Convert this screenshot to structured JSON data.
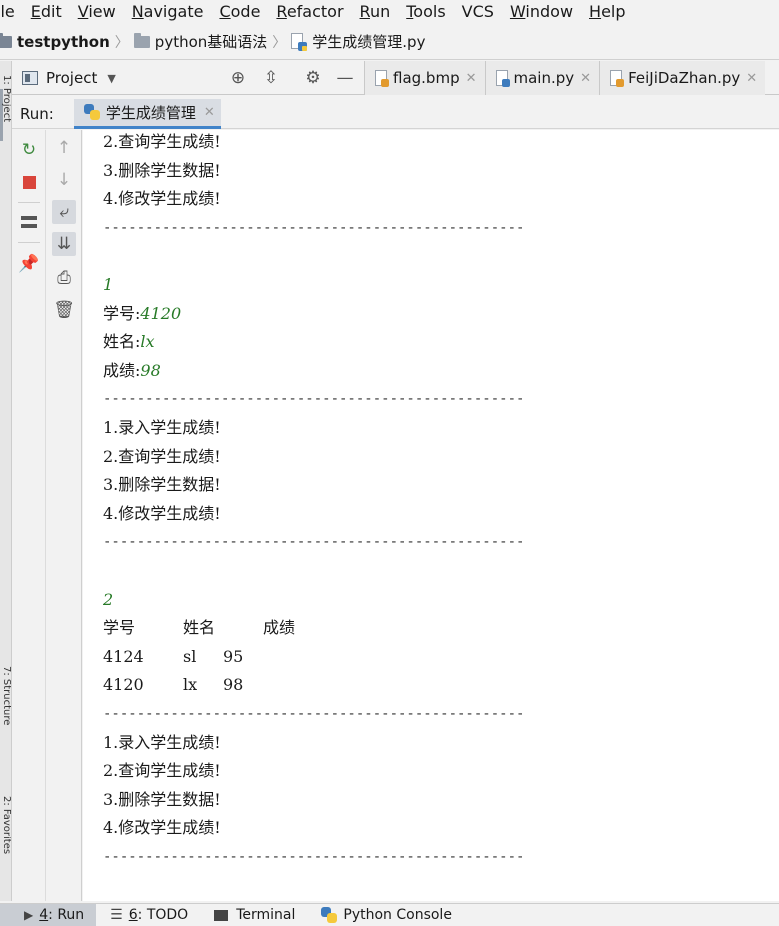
{
  "menu": [
    "ile",
    "Edit",
    "View",
    "Navigate",
    "Code",
    "Refactor",
    "Run",
    "Tools",
    "VCS",
    "Window",
    "Help"
  ],
  "menu_mnemonics": [
    "",
    "E",
    "V",
    "N",
    "C",
    "R",
    "R",
    "T",
    "",
    "W",
    "H"
  ],
  "breadcrumb": {
    "project": "testpython",
    "folder": "python基础语法",
    "file": "学生成绩管理.py"
  },
  "toolbar": {
    "project_label": "Project",
    "tabs": [
      {
        "label": "flag.bmp",
        "icon": "image-file-icon"
      },
      {
        "label": "main.py",
        "icon": "python-file-icon"
      },
      {
        "label": "FeiJiDaZhan.py",
        "icon": "python-file-icon"
      }
    ]
  },
  "side_strip": {
    "top_label": "1: Project",
    "mid_label": "7: Structure",
    "bottom_label": "2: Favorites"
  },
  "run": {
    "label": "Run:",
    "tab": "学生成绩管理"
  },
  "console": {
    "lines": [
      {
        "text": "2.查询学生成绩!"
      },
      {
        "text": "3.删除学生数据!"
      },
      {
        "text": "4.修改学生成绩!"
      },
      {
        "text": "--------------------------------------------------",
        "dash": true
      },
      {
        "text": ""
      },
      {
        "text": "1",
        "input": true
      },
      {
        "text": "学号:",
        "input_suffix": "4120"
      },
      {
        "text": "姓名:",
        "input_suffix": "lx"
      },
      {
        "text": "成绩:",
        "input_suffix": "98"
      },
      {
        "text": "--------------------------------------------------",
        "dash": true
      },
      {
        "text": "1.录入学生成绩!"
      },
      {
        "text": "2.查询学生成绩!"
      },
      {
        "text": "3.删除学生数据!"
      },
      {
        "text": "4.修改学生成绩!"
      },
      {
        "text": "--------------------------------------------------",
        "dash": true
      },
      {
        "text": ""
      },
      {
        "text": "2",
        "input": true
      }
    ],
    "table_header": [
      "学号",
      "姓名",
      "成绩"
    ],
    "table_rows": [
      [
        "4124",
        "sl",
        "95"
      ],
      [
        "4120",
        "lx",
        "98"
      ]
    ],
    "after_lines": [
      {
        "text": "--------------------------------------------------",
        "dash": true
      },
      {
        "text": "1.录入学生成绩!"
      },
      {
        "text": "2.查询学生成绩!"
      },
      {
        "text": "3.删除学生数据!"
      },
      {
        "text": "4.修改学生成绩!"
      },
      {
        "text": "--------------------------------------------------",
        "dash": true
      }
    ]
  },
  "bottom_tabs": [
    {
      "num": "4",
      "label": ": Run"
    },
    {
      "num": "6",
      "label": ": TODO"
    },
    {
      "num": "",
      "label": "Terminal"
    },
    {
      "num": "",
      "label": "Python Console"
    }
  ]
}
